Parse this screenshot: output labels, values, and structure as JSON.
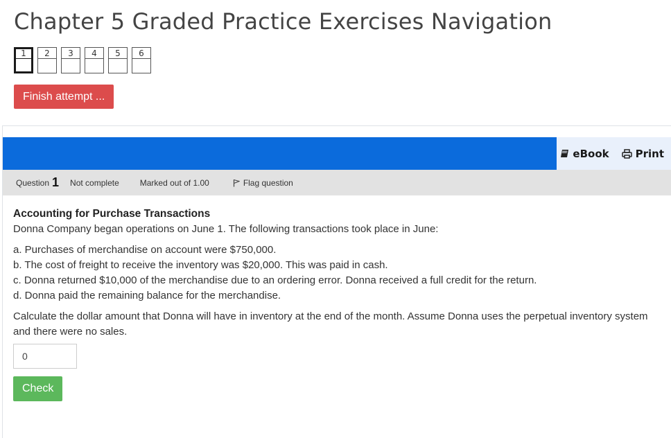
{
  "nav": {
    "title": "Chapter 5 Graded Practice Exercises Navigation",
    "questions": [
      "1",
      "2",
      "3",
      "4",
      "5",
      "6"
    ],
    "current_question": "1",
    "finish_label": "Finish attempt ..."
  },
  "toolbar": {
    "ebook_label": "eBook",
    "print_label": "Print"
  },
  "question_info": {
    "label": "Question",
    "number": "1",
    "state": "Not complete",
    "grade": "Marked out of 1.00",
    "flag_label": "Flag question"
  },
  "question": {
    "heading": "Accounting for Purchase Transactions",
    "intro": "Donna Company began operations on June 1. The following transactions took place in June:",
    "items": [
      "a. Purchases of merchandise on account were $750,000.",
      "b. The cost of freight to receive the inventory was $20,000. This was paid in cash.",
      "c. Donna returned $10,000 of the merchandise due to an ordering error. Donna received a full credit for the return.",
      "d. Donna paid the remaining balance for the merchandise."
    ],
    "prompt": "Calculate the dollar amount that Donna will have in inventory at the end of the month. Assume Donna uses the perpetual inventory system and there were no sales.",
    "answer_value": "0",
    "check_label": "Check"
  },
  "colors": {
    "blue_bar": "#0b6bdc",
    "finish_button": "#dc4c4c",
    "check_button": "#5cb85c",
    "info_bar": "#e2e2e2"
  }
}
